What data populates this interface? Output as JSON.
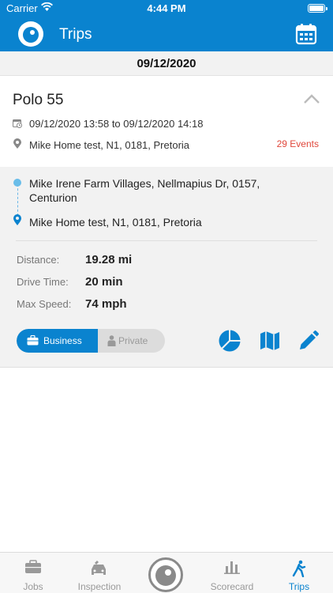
{
  "status_bar": {
    "carrier": "Carrier",
    "time": "4:44 PM"
  },
  "header": {
    "title": "Trips"
  },
  "date": "09/12/2020",
  "trip": {
    "vehicle": "Polo 55",
    "time_range": "09/12/2020 13:58 to 09/12/2020 14:18",
    "location": "Mike Home test, N1, 0181, Pretoria",
    "events": "29 Events",
    "from": "Mike Irene Farm Villages, Nellmapius Dr, 0157, Centurion",
    "to": "Mike Home test, N1, 0181, Pretoria",
    "stats": {
      "distance_label": "Distance:",
      "distance_value": "19.28 mi",
      "drive_time_label": "Drive Time:",
      "drive_time_value": "20 min",
      "max_speed_label": "Max Speed:",
      "max_speed_value": "74 mph"
    },
    "toggle": {
      "business": "Business",
      "private": "Private",
      "selected": "Business"
    }
  },
  "tabs": [
    {
      "label": "Jobs",
      "icon": "briefcase-icon"
    },
    {
      "label": "Inspection",
      "icon": "car-wrench-icon"
    },
    {
      "label": "",
      "icon": "app-logo-icon"
    },
    {
      "label": "Scorecard",
      "icon": "bar-chart-icon"
    },
    {
      "label": "Trips",
      "icon": "walking-person-icon",
      "active": true
    }
  ],
  "colors": {
    "primary": "#0a83cf",
    "events": "#e0483c",
    "panel": "#f2f2f2"
  }
}
